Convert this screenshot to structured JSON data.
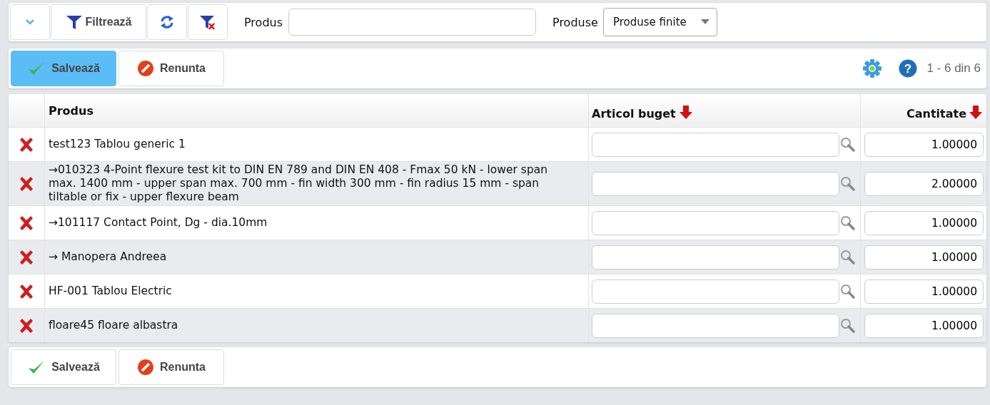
{
  "toolbar": {
    "filter_button": "Filtrează",
    "product_label": "Produs",
    "products_label": "Produse",
    "products_select": "Produse finite"
  },
  "actions_top": {
    "save": {
      "label": "Salvează",
      "selected": true
    },
    "cancel": {
      "label": "Renunta",
      "selected": false
    },
    "help": "?",
    "pagination": "1 - 6 din 6"
  },
  "table": {
    "columns": [
      "Produs",
      "Articol buget",
      "Cantitate"
    ],
    "rows": [
      {
        "product": "test123 Tablou generic 1",
        "quantity": "1.00000"
      },
      {
        "product": "→010323 4-Point flexure test kit to DIN EN 789 and DIN EN 408 - Fmax 50 kN - lower span max. 1400 mm - upper span max. 700 mm - fin width 300 mm - fin radius 15 mm - span tiltable or fix - upper flexure beam",
        "quantity": "2.00000"
      },
      {
        "product": "→101117 Contact Point, Dg - dia.10mm",
        "quantity": "1.00000"
      },
      {
        "product": "→ Manopera Andreea",
        "quantity": "1.00000"
      },
      {
        "product": "HF-001 Tablou Electric",
        "quantity": "1.00000"
      },
      {
        "product": "floare45 floare albastra",
        "quantity": "1.00000"
      }
    ]
  },
  "actions_bottom": {
    "save": {
      "label": "Salvează",
      "selected": false
    },
    "cancel": {
      "label": "Renunta",
      "selected": false
    }
  }
}
